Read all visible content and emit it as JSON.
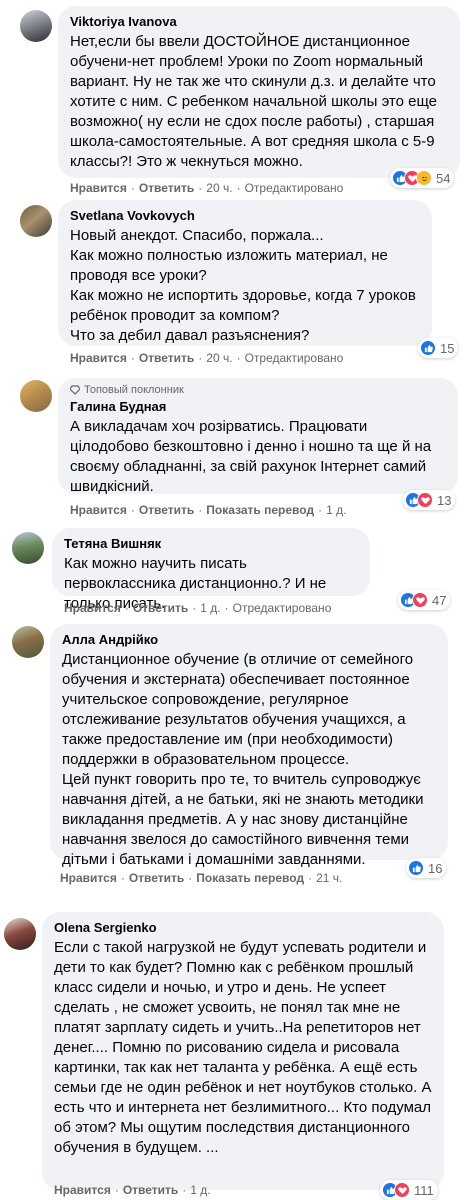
{
  "labels": {
    "like": "Нравится",
    "reply": "Ответить",
    "show_translation": "Показать перевод",
    "edited": "Отредактировано",
    "separator": "·"
  },
  "comments": [
    {
      "author": "Viktoriya Ivanova",
      "text": "Нет,если бы ввели ДОСТОЙНОЕ дистанционное обучени-нет проблем! Уроки по Zoom нормальный вариант. Ну не так же что скинули д.з. и делайте что хотите с ним. С ребенком начальной школы это еще возможно( ну если не сдох после работы) , старшая школа-самостоятельные. А вот средняя школа с 5-9 классы?! Это ж чекнуться можно.",
      "time": "20 ч.",
      "reactions": [
        "like",
        "love",
        "care"
      ],
      "count": "54"
    },
    {
      "author": "Svetlana Vovkovych",
      "text": "Новый анекдот. Спасибо, поржала...\nКак можно полностью изложить материал, не проводя все уроки?\nКак можно не испортить здоровье, когда 7 уроков ребёнок проводит за компом?\nЧто за дебил давал разъяснения?",
      "time": "20 ч.",
      "reactions": [
        "like"
      ],
      "count": "15"
    },
    {
      "badge": "Топовый поклонник",
      "author": "Галина Будная",
      "text": "А викладачам хоч розірватись. Працювати цілодобово безкоштовно і денно і ношно та ще й на своєму обладнанні, за свій рахунок Інтернет самий швидкісний.",
      "time": "1 д.",
      "reactions": [
        "like",
        "love"
      ],
      "count": "13"
    },
    {
      "author": "Тетяна Вишняк",
      "text": "Как можно научить писать первоклассника дистанционно.? И не только писать.",
      "time": "1 д.",
      "reactions": [
        "like",
        "love"
      ],
      "count": "47"
    },
    {
      "author": "Алла Андрійко",
      "text": "Дистанционное обучение (в отличие от семейного обучения и экстерната) обеспечивает постоянное учительское сопровождение, регулярное отслеживание результатов обучения учащихся, а также предоставление им (при необходимости) поддержки в образовательном процессе.\nЦей пункт говорить про те, то вчитель супроводжує навчання дітей, а не батьки, які не знають методики викладання предметів. А у нас знову дистанційне навчання звелося до самостійного вивчення теми дітьми і батьками і домашніми завданнями.",
      "time": "21 ч.",
      "reactions": [
        "like"
      ],
      "count": "16"
    },
    {
      "author": "Olena Sergienko",
      "text": "Если с такой нагрузкой не будут успевать родители и дети то как будет? Помню как с ребёнком прошлый класс сидели и ночью, и утро и день. Не успеет сделать , не сможет усвоить, не понял так мне не платят зарплату сидеть и учить..На репетиторов нет денег.... Помню по рисованию сидела и рисовала картинки, так как нет таланта у ребёнка. А ещё есть семьи где не один ребёнок и нет ноутбуков столько. А есть что и интернета нет безлимитного... Кто подумал об этом? Мы ощутим последствия дистанционного обучения в будущем. ...",
      "time": "1 д.",
      "reactions": [
        "like",
        "love"
      ],
      "count": "111"
    }
  ]
}
